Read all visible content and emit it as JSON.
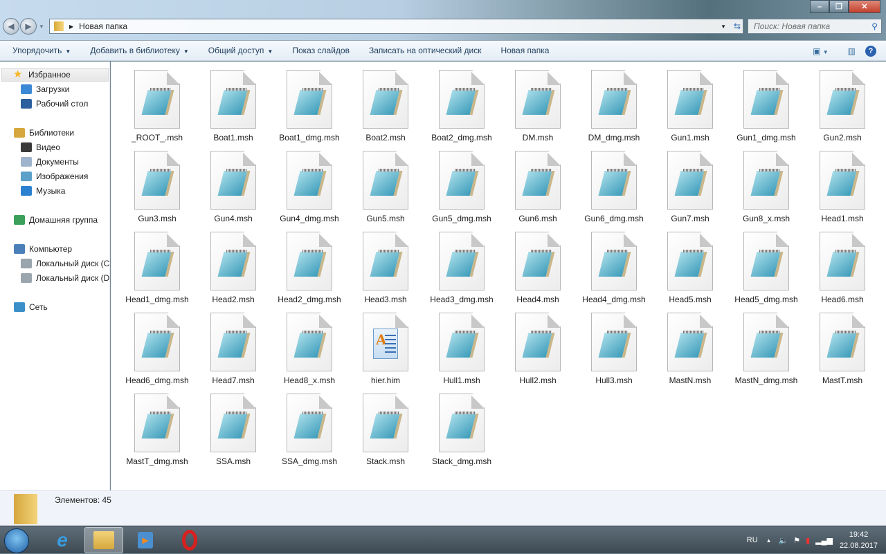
{
  "window": {
    "address": "Новая папка",
    "search_placeholder": "Поиск: Новая папка"
  },
  "toolbar": {
    "organize": "Упорядочить",
    "add_to_library": "Добавить в библиотеку",
    "share": "Общий доступ",
    "slideshow": "Показ слайдов",
    "burn": "Записать на оптический диск",
    "new_folder": "Новая папка"
  },
  "sidebar": [
    {
      "label": "Избранное",
      "icon": "star-icon",
      "color": "#f5b522",
      "indent": false,
      "selected": true
    },
    {
      "label": "Загрузки",
      "icon": "downloads-folder-icon",
      "color": "#3b88d4",
      "indent": true
    },
    {
      "label": "Рабочий стол",
      "icon": "desktop-icon",
      "color": "#2c5f9e",
      "indent": true
    },
    {
      "label": "Библиотеки",
      "icon": "libraries-icon",
      "color": "#d5a73d",
      "indent": false
    },
    {
      "label": "Видео",
      "icon": "video-icon",
      "color": "#3a3a3a",
      "indent": true
    },
    {
      "label": "Документы",
      "icon": "documents-icon",
      "color": "#9fb4cc",
      "indent": true
    },
    {
      "label": "Изображения",
      "icon": "pictures-icon",
      "color": "#5aa0c8",
      "indent": true
    },
    {
      "label": "Музыка",
      "icon": "music-icon",
      "color": "#2b80d0",
      "indent": true
    },
    {
      "label": "Домашняя группа",
      "icon": "homegroup-icon",
      "color": "#3aa05a",
      "indent": false
    },
    {
      "label": "Компьютер",
      "icon": "computer-icon",
      "color": "#4a7fb8",
      "indent": false
    },
    {
      "label": "Локальный диск (C:)",
      "icon": "drive-icon",
      "color": "#9aa5ad",
      "indent": true
    },
    {
      "label": "Локальный диск (D:)",
      "icon": "drive-icon",
      "color": "#9aa5ad",
      "indent": true
    },
    {
      "label": "Сеть",
      "icon": "network-icon",
      "color": "#3a8fc8",
      "indent": false
    }
  ],
  "files": [
    "_ROOT_.msh",
    "Boat1.msh",
    "Boat1_dmg.msh",
    "Boat2.msh",
    "Boat2_dmg.msh",
    "DM.msh",
    "DM_dmg.msh",
    "Gun1.msh",
    "Gun1_dmg.msh",
    "Gun2.msh",
    "Gun3.msh",
    "Gun4.msh",
    "Gun4_dmg.msh",
    "Gun5.msh",
    "Gun5_dmg.msh",
    "Gun6.msh",
    "Gun6_dmg.msh",
    "Gun7.msh",
    "Gun8_x.msh",
    "Head1.msh",
    "Head1_dmg.msh",
    "Head2.msh",
    "Head2_dmg.msh",
    "Head3.msh",
    "Head3_dmg.msh",
    "Head4.msh",
    "Head4_dmg.msh",
    "Head5.msh",
    "Head5_dmg.msh",
    "Head6.msh",
    "Head6_dmg.msh",
    "Head7.msh",
    "Head8_x.msh",
    "hier.him",
    "Hull1.msh",
    "Hull2.msh",
    "Hull3.msh",
    "MastN.msh",
    "MastN_dmg.msh",
    "MastT.msh",
    "MastT_dmg.msh",
    "SSA.msh",
    "SSA_dmg.msh",
    "Stack.msh",
    "Stack_dmg.msh"
  ],
  "status": {
    "count": "Элементов: 45"
  },
  "taskbar": {
    "lang": "RU",
    "time": "19:42",
    "date": "22.08.2017"
  }
}
